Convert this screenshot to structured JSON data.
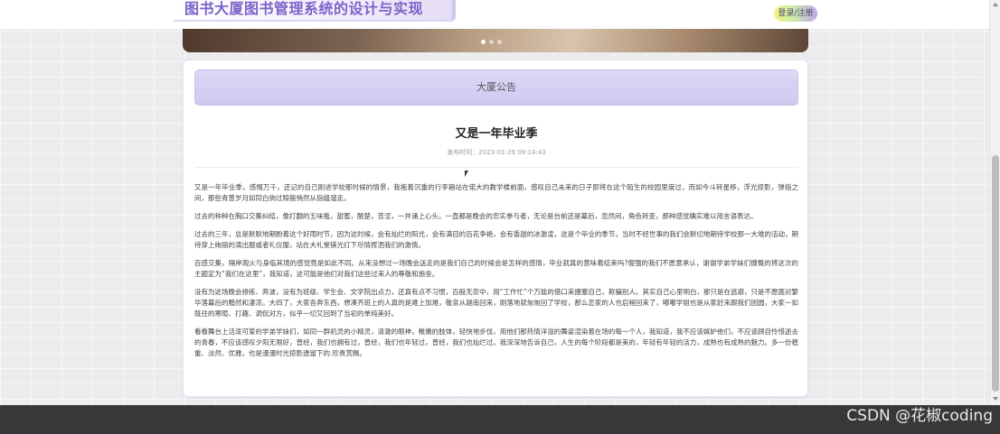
{
  "header": {
    "site_title": "图书大厦图书管理系统的设计与实现",
    "login_label": "登录/注册"
  },
  "carousel": {
    "slides": 3,
    "active_slide": 1
  },
  "notice": {
    "section_title": "大厦公告",
    "article_title": "又是一年毕业季",
    "publish_time": "发布时间：2023-01-29 09:14:43",
    "paragraphs": [
      "又是一年毕业季，感慨万千，还记的自己刚进学校那时候的情景，我拖着沉重的行李箱站在偌大的教学楼前面，感叹自己未来的日子即将在这个陌生的校园里度过，而如今斗转星移，浮光掠影，弹指之间，那些青葱岁月如同白驹过隙般悄然从指缝溜走。",
      "过去的种种在胸口交集纠结，像打翻的五味瓶，甜蜜，酸楚，苦涩，一并涌上心头。一直都是晚会的忠实参与者，无论是台前还是幕后，忽然间，角色转变，那种感觉确实难以用言语表达。",
      "过去的三年，总是默默地期盼着这个好雨时节，因为这时候，会有灿烂的阳光，会有满目的百花争艳，会有香甜的冰激凌，这是个毕业的季节，当时不经世事的我们会默切地期待学校那一大堆的活动，期待穿上绚丽的演出服或者礼仪服，站在大礼堂镁光灯下尽情挥洒我们的激情。",
      "百感交集，隔岸观火与身临其境的感觉竟是如此不同。从来没想过一场晚会送走的是我们自己的时候会是怎样的感情，毕业就真的意味着结束吗?倔强的我们不愿意承认，谢谢学弟学妹们慷慨的将这次的主题定为“我们在这里”，我知道，这可能是他们对我们这些过来人的尊敬和施舍。",
      "没有为这场晚会排练、奔波，没有为班级、学生会、文学院出点力，还真有点不习惯，百般无奈中，用“工作忙”个万能的借口来搪塞自己，欺骗别人。其实自己心里明白，那只是在逃避，只是不愿面对繁华落幕后的黯然和凄凉。大四了，大家各奔东西，想凑齐班上的人真的是难上加难，敬亲从越南回来，刚落地就匆匆回了学校，那么恋家的人也启程回来了，嘟嘟学姐也是从家赶来跟我们团圆，大家一如既往的寒暄、打趣、调侃对方，似乎一切又回到了当初的单纯美好。",
      "看看舞台上活泼可爱的学弟学妹们，如同一群机灵的小精灵，清澈的眼神，稚嫩的肢体，轻快地步伐，用他们那热情洋溢的舞姿渲染着在场的每一个人，我知道，我不应该嫉妒他们，不应该顾自怜惜逝去的青春，不应该感叹夕阳无限好，曾经，我们也拥有过，曾经，我们也年轻过，曾经，我们也灿烂过。我深深地告诉自己，人生的每个阶段都是美的，年轻有年轻的活力，成熟也有成熟的魅力。多一份稳重、淡然、优雅，也是漫漫时光掠影遗留下的.珍贵赏赐。"
    ]
  },
  "watermark": "CSDN @花椒coding"
}
